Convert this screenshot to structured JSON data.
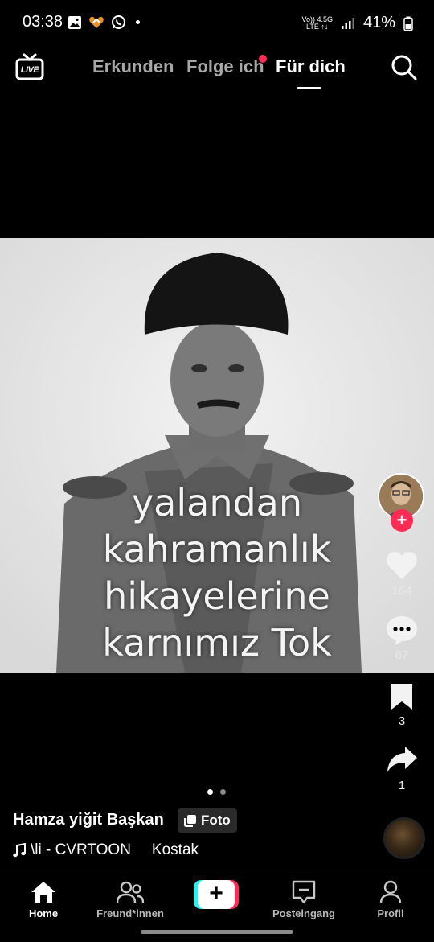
{
  "status_bar": {
    "time": "03:38",
    "battery": "41%",
    "net_top": "Vo)) 4.5G",
    "net_bottom": "LTE ↑↓",
    "left_icons": [
      "gallery-icon",
      "heart-app-icon",
      "whatsapp-icon",
      "dot-icon"
    ],
    "right_icons": [
      "signal-icon",
      "battery-icon"
    ]
  },
  "top_nav": {
    "live_label": "LIVE",
    "tabs": [
      {
        "label": "Erkunden",
        "active": false
      },
      {
        "label": "Folge ich",
        "active": false,
        "has_notification": true
      },
      {
        "label": "Für dich",
        "active": true
      }
    ],
    "search_icon": "search-icon"
  },
  "post": {
    "caption_lines": [
      "yalandan",
      "kahramanlık",
      "hikayelerine",
      "karnımız Tok"
    ],
    "slide_count": 2,
    "active_slide": 1
  },
  "rail": {
    "likes": "164",
    "comments": "67",
    "bookmarks": "3",
    "shares": "1",
    "follow_plus": "+"
  },
  "info": {
    "author": "Hamza yiğit Başkan",
    "badge": "Foto",
    "music_primary": "\\li - CVRTOON",
    "music_secondary": "Kostak"
  },
  "bottom_nav": {
    "items": [
      {
        "label": "Home",
        "icon": "home-icon",
        "active": true
      },
      {
        "label": "Freund*innen",
        "icon": "friends-icon",
        "active": false
      },
      {
        "label": "",
        "icon": "create-icon",
        "active": false
      },
      {
        "label": "Posteingang",
        "icon": "inbox-icon",
        "active": false
      },
      {
        "label": "Profil",
        "icon": "profile-icon",
        "active": false
      }
    ],
    "create_symbol": "+"
  },
  "colors": {
    "accent": "#fe2c55",
    "cyan": "#25f4ee",
    "background": "#000000"
  }
}
